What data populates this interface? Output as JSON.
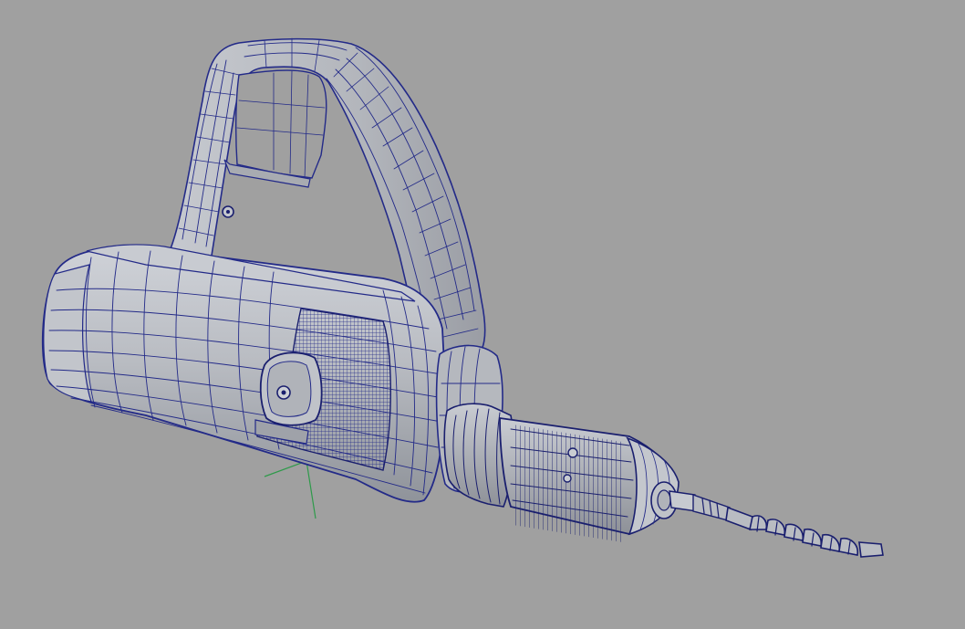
{
  "viewport": {
    "background": "#a0a0a0",
    "model": "power-drill",
    "display_mode": "wireframe-on-shaded",
    "colors": {
      "surface": "#b9bcc2",
      "surface_shade": "#9ea1a8",
      "surface_light": "#cdd0d6",
      "wire": "#232a88",
      "wire_dense": "#1a1f6e",
      "axis_manipulator": "#2e9a4a"
    }
  }
}
